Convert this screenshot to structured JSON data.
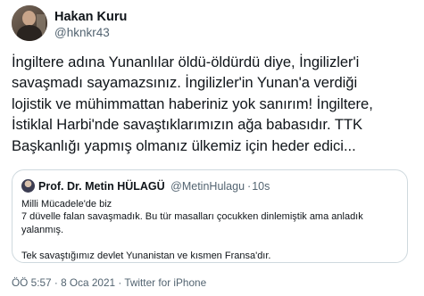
{
  "author": {
    "display_name": "Hakan Kuru",
    "handle": "@hknkr43"
  },
  "tweet": {
    "text": "İngiltere adına Yunanlılar öldü-öldürdü diye, İngilizler'i\nsavaşmadı sayamazsınız. İngilizler'in Yunan'a verdiği\nlojistik ve mühimmattan haberiniz yok sanırım! İngiltere,\nİstiklal Harbi'nde savaştıklarımızın ağa babasıdır. TTK\nBaşkanlığı yapmış olmanız ülkemiz için heder edici..."
  },
  "quoted_tweet": {
    "display_name": "Prof. Dr. Metin HÜLAGÜ",
    "handle": "@MetinHulagu",
    "separator": "·",
    "age": "10s",
    "text": "Milli Mücadele'de biz\n7 düvelle falan savaşmadık. Bu tür masalları çocukken dinlemiştik ama anladık\nyalanmış.\n\nTek savaştığımız devlet Yunanistan ve kısmen Fransa'dır."
  },
  "meta": {
    "footer": "ÖÖ 5:57 · 8 Oca 2021 · Twitter for iPhone"
  }
}
